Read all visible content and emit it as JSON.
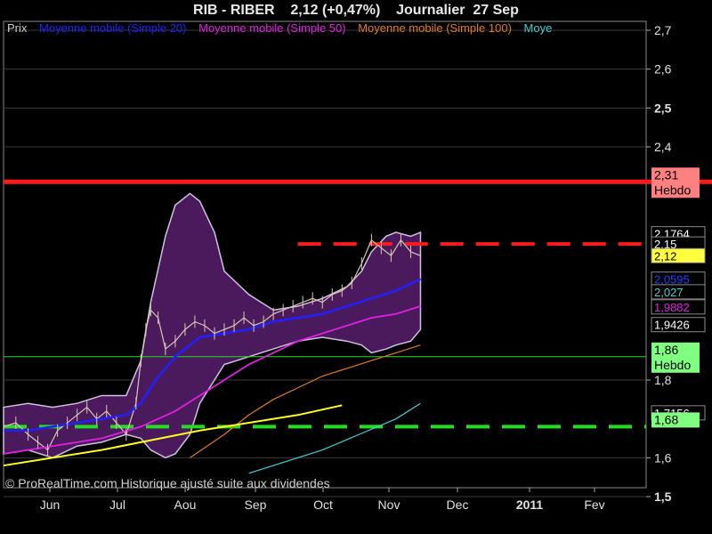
{
  "header": {
    "title": "RIB - RIBER    2,12 (+0,47%)    Journalier  27 Sep"
  },
  "legend": [
    {
      "label": "Prix",
      "color": "#cccccc"
    },
    {
      "label": "Moyenne mobile (Simple 20)",
      "color": "#2020ff"
    },
    {
      "label": "Moyenne mobile (Simple 50)",
      "color": "#e020e0"
    },
    {
      "label": "Moyenne mobile (Simple 100)",
      "color": "#e07a20"
    },
    {
      "label": "Moye",
      "color": "#40d0d0"
    }
  ],
  "watermark": "© ProRealTime.com Historique ajusté suite aux dividendes",
  "colors": {
    "background": "#000000",
    "band_fill": "#4a1a5c",
    "price": "#d8c8b8",
    "resistance": "#ff1a1a",
    "support": "#22dd22",
    "trend": "#ffff20"
  },
  "chart_data": {
    "type": "line",
    "ylim": [
      1.5,
      2.7
    ],
    "y_ticks": [
      {
        "value": 2.7,
        "label": "2,7",
        "bold": false
      },
      {
        "value": 2.6,
        "label": "2,6",
        "bold": false
      },
      {
        "value": 2.5,
        "label": "2,5",
        "bold": true
      },
      {
        "value": 2.4,
        "label": "2,4",
        "bold": false
      },
      {
        "value": 1.8,
        "label": "1,8",
        "bold": false
      },
      {
        "value": 1.6,
        "label": "1,6",
        "bold": false
      },
      {
        "value": 1.5,
        "label": "1,5",
        "bold": true
      }
    ],
    "x_ticks": [
      {
        "label": "Jun",
        "bold": false
      },
      {
        "label": "Jul",
        "bold": false
      },
      {
        "label": "Aou",
        "bold": false
      },
      {
        "label": "Sep",
        "bold": false
      },
      {
        "label": "Oct",
        "bold": false
      },
      {
        "label": "Nov",
        "bold": false
      },
      {
        "label": "Dec",
        "bold": false
      },
      {
        "label": "2011",
        "bold": true
      },
      {
        "label": "Fev",
        "bold": false
      }
    ],
    "price_levels": [
      {
        "value": 2.1764,
        "label": "2,1764",
        "bg": "#000000",
        "fg": "#ffffff"
      },
      {
        "value": 2.15,
        "label": "2,15",
        "bg": "#000000",
        "fg": "#ffffff"
      },
      {
        "value": 2.12,
        "label": "2,12",
        "bg": "#ffff40",
        "fg": "#000000"
      },
      {
        "value": 2.0595,
        "label": "2,0595",
        "bg": "#000000",
        "fg": "#2040ff"
      },
      {
        "value": 2.027,
        "label": "2,027",
        "bg": "#000000",
        "fg": "#40d0d0"
      },
      {
        "value": 1.9882,
        "label": "1,9882",
        "bg": "#000000",
        "fg": "#e020e0"
      },
      {
        "value": 1.9426,
        "label": "1,9426",
        "bg": "#000000",
        "fg": "#ffffff"
      },
      {
        "value": 1.7156,
        "label": "1,7156",
        "bg": "#000000",
        "fg": "#ffffff"
      }
    ],
    "levels": [
      {
        "name": "resistance",
        "value": 2.31,
        "label": "2,31",
        "sublabel": "Hebdo",
        "bg": "#ff8080"
      },
      {
        "name": "support",
        "value": 1.86,
        "label": "1,86",
        "sublabel": "Hebdo",
        "bg": "#80ff80"
      },
      {
        "name": "support-dashed",
        "value": 1.68,
        "label": "1,68",
        "sublabel": "",
        "bg": "#80ff80"
      },
      {
        "name": "resistance-dashed",
        "value": 2.15,
        "label": "",
        "sublabel": "",
        "bg": ""
      }
    ],
    "x_range_days": [
      0,
      262
    ],
    "series": [
      {
        "key": "price",
        "x": [
          0,
          5,
          10,
          14,
          18,
          22,
          26,
          30,
          34,
          38,
          42,
          46,
          50,
          54,
          56,
          58,
          60,
          63,
          66,
          70,
          74,
          78,
          82,
          86,
          90,
          94,
          98,
          102,
          106,
          110,
          114,
          118,
          122,
          126,
          130,
          134,
          138,
          142,
          146,
          150,
          154,
          158,
          162,
          166,
          170
        ],
        "values": [
          1.68,
          1.69,
          1.66,
          1.64,
          1.62,
          1.67,
          1.69,
          1.71,
          1.73,
          1.7,
          1.72,
          1.69,
          1.66,
          1.74,
          1.85,
          1.93,
          1.98,
          1.96,
          1.88,
          1.9,
          1.93,
          1.95,
          1.94,
          1.92,
          1.93,
          1.94,
          1.96,
          1.94,
          1.95,
          1.97,
          1.98,
          1.99,
          2.0,
          2.01,
          2.0,
          2.02,
          2.03,
          2.05,
          2.1,
          2.16,
          2.14,
          2.12,
          2.16,
          2.13,
          2.12
        ]
      },
      {
        "key": "sma20",
        "x": [
          0,
          10,
          20,
          30,
          40,
          50,
          56,
          62,
          70,
          80,
          90,
          100,
          110,
          120,
          130,
          140,
          150,
          160,
          170
        ],
        "values": [
          1.67,
          1.67,
          1.68,
          1.69,
          1.7,
          1.71,
          1.74,
          1.8,
          1.86,
          1.91,
          1.92,
          1.93,
          1.95,
          1.96,
          1.97,
          1.99,
          2.01,
          2.03,
          2.06
        ]
      },
      {
        "key": "sma50",
        "x": [
          0,
          20,
          40,
          56,
          70,
          80,
          90,
          100,
          110,
          120,
          130,
          140,
          150,
          160,
          170
        ],
        "values": [
          1.61,
          1.63,
          1.65,
          1.68,
          1.72,
          1.76,
          1.8,
          1.84,
          1.87,
          1.9,
          1.92,
          1.94,
          1.96,
          1.97,
          1.99
        ]
      },
      {
        "key": "sma100",
        "x": [
          76,
          90,
          100,
          110,
          120,
          130,
          140,
          150,
          160,
          170
        ],
        "values": [
          1.6,
          1.66,
          1.71,
          1.75,
          1.78,
          1.81,
          1.83,
          1.85,
          1.87,
          1.89
        ]
      },
      {
        "key": "sma200",
        "x": [
          100,
          115,
          130,
          145,
          160,
          170
        ],
        "values": [
          1.56,
          1.59,
          1.62,
          1.66,
          1.7,
          1.74
        ]
      },
      {
        "key": "trend",
        "x": [
          0,
          40,
          80,
          120,
          138
        ],
        "values": [
          1.58,
          1.62,
          1.67,
          1.71,
          1.735
        ]
      }
    ],
    "bollinger": {
      "x": [
        0,
        10,
        20,
        30,
        40,
        50,
        56,
        60,
        66,
        70,
        76,
        80,
        86,
        90,
        100,
        110,
        120,
        130,
        140,
        146,
        150,
        156,
        160,
        166,
        170
      ],
      "upper": [
        1.73,
        1.74,
        1.73,
        1.74,
        1.76,
        1.76,
        1.85,
        2.0,
        2.17,
        2.25,
        2.28,
        2.26,
        2.18,
        2.08,
        2.02,
        1.98,
        1.99,
        2.01,
        2.04,
        2.08,
        2.13,
        2.17,
        2.18,
        2.17,
        2.18
      ],
      "lower": [
        1.61,
        1.62,
        1.6,
        1.63,
        1.64,
        1.66,
        1.65,
        1.62,
        1.6,
        1.61,
        1.66,
        1.74,
        1.8,
        1.84,
        1.86,
        1.88,
        1.9,
        1.91,
        1.9,
        1.89,
        1.87,
        1.88,
        1.89,
        1.9,
        1.93
      ]
    }
  }
}
